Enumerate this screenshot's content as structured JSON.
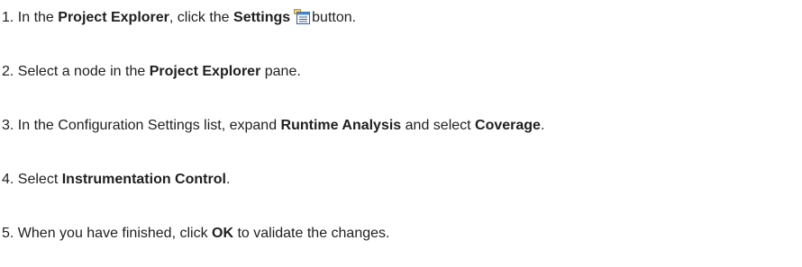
{
  "steps": [
    {
      "number": "1.",
      "t1": "In the ",
      "b1": "Project Explorer",
      "t2": ", click the ",
      "b2": "Settings",
      "icon": "settings-icon",
      "t3": "button."
    },
    {
      "number": "2.",
      "t1": "Select a node in the ",
      "b1": "Project Explorer",
      "t2": " pane."
    },
    {
      "number": "3.",
      "t1": "In the Configuration Settings list, expand ",
      "b1": "Runtime Analysis",
      "t2": " and select ",
      "b2": "Coverage",
      "t3": "."
    },
    {
      "number": "4.",
      "t1": "Select ",
      "b1": "Instrumentation Control",
      "t2": "."
    },
    {
      "number": "5.",
      "t1": "When you have finished, click ",
      "b1": "OK",
      "t2": " to validate the changes."
    }
  ]
}
